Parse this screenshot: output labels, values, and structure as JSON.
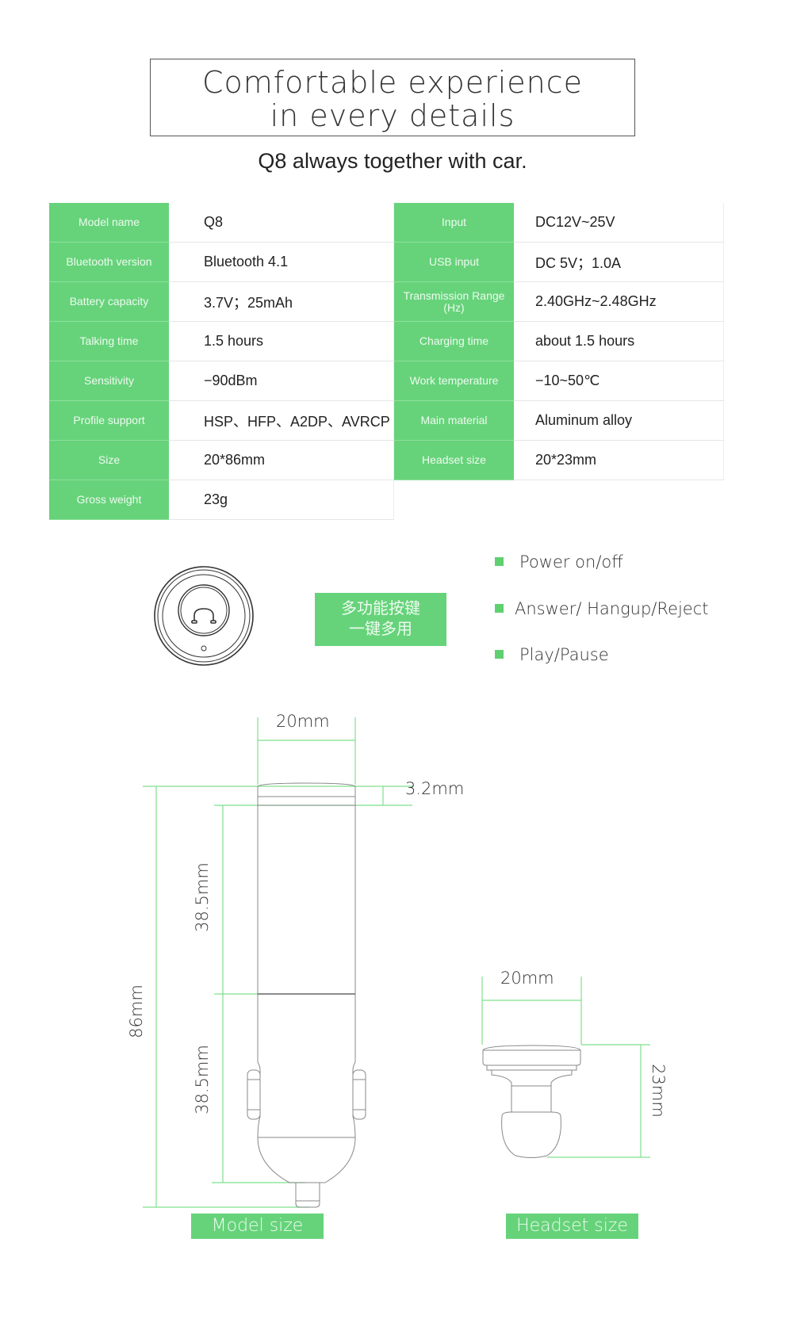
{
  "header": {
    "title_line1": "Comfortable experience",
    "title_line2": "in every details",
    "subtitle": "Q8 always together with car."
  },
  "specs": {
    "left": [
      {
        "label": "Model name",
        "value": "Q8"
      },
      {
        "label": "Bluetooth version",
        "value": "Bluetooth 4.1"
      },
      {
        "label": "Battery capacity",
        "value": "3.7V；25mAh"
      },
      {
        "label": "Talking time",
        "value": "1.5 hours"
      },
      {
        "label": "Sensitivity",
        "value": "−90dBm"
      },
      {
        "label": "Profile support",
        "value": "HSP、HFP、A2DP、AVRCP"
      },
      {
        "label": "Size",
        "value": "20*86mm"
      },
      {
        "label": "Gross weight",
        "value": "23g"
      }
    ],
    "right": [
      {
        "label": "Input",
        "value": "DC12V~25V"
      },
      {
        "label": "USB input",
        "value": "DC 5V；1.0A"
      },
      {
        "label": "Transmission Range (Hz)",
        "value": "2.40GHz~2.48GHz"
      },
      {
        "label": "Charging time",
        "value": "about 1.5 hours"
      },
      {
        "label": "Work temperature",
        "value": "−10~50℃"
      },
      {
        "label": "Main material",
        "value": "Aluminum alloy"
      },
      {
        "label": "Headset size",
        "value": "20*23mm"
      }
    ]
  },
  "button_section": {
    "multi_function_line1": "多功能按键",
    "multi_function_line2": "一键多用",
    "features": [
      "Power on/off",
      "Answer/ Hangup/Reject",
      "Play/Pause"
    ],
    "button_icon": "phone-handset-icon"
  },
  "dimensions": {
    "charger": {
      "width": "20mm",
      "cap_height": "3.2mm",
      "upper_section": "38.5mm",
      "lower_section": "38.5mm",
      "total_length": "86mm",
      "caption": "Model size"
    },
    "headset": {
      "width": "20mm",
      "height": "23mm",
      "caption": "Headset size"
    }
  },
  "colors": {
    "accent_green": "#66d37a",
    "dimension_line_green": "#7ee08c"
  }
}
